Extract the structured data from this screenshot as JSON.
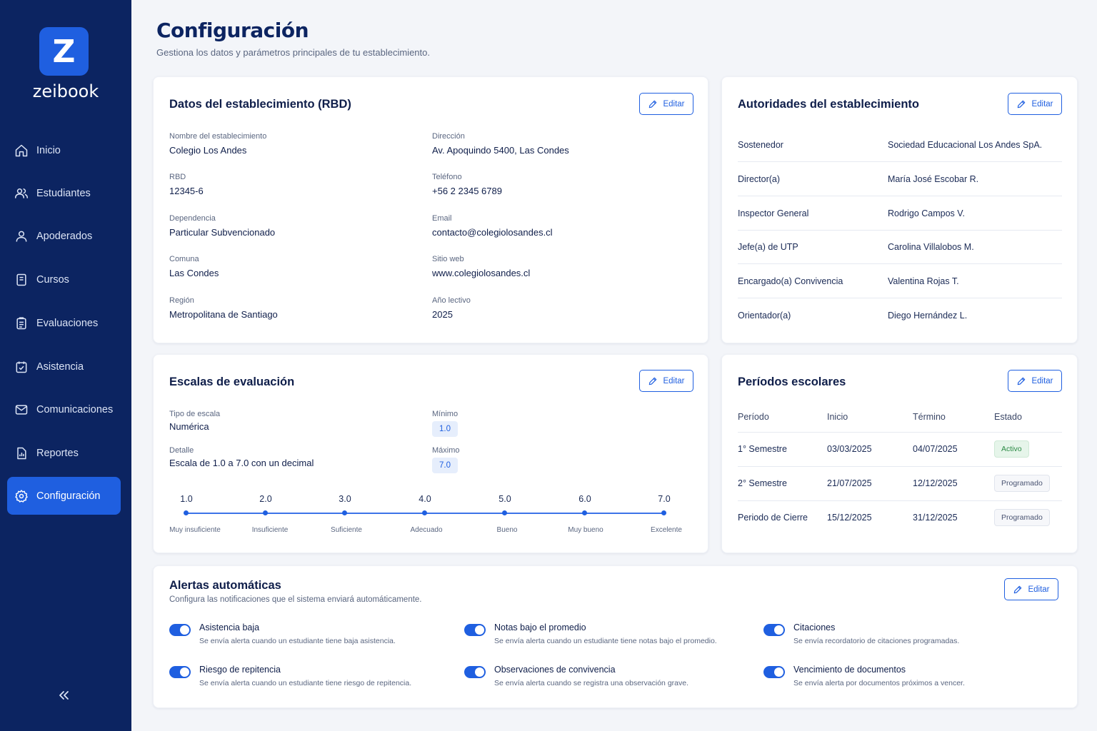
{
  "brand": {
    "letter": "Z",
    "name": "zeibook"
  },
  "sidebar": {
    "items": [
      {
        "label": "Inicio",
        "icon": "home-icon"
      },
      {
        "label": "Estudiantes",
        "icon": "users-icon"
      },
      {
        "label": "Apoderados",
        "icon": "user-icon"
      },
      {
        "label": "Cursos",
        "icon": "book-icon"
      },
      {
        "label": "Evaluaciones",
        "icon": "clipboard-icon"
      },
      {
        "label": "Asistencia",
        "icon": "calendar-check-icon"
      },
      {
        "label": "Comunicaciones",
        "icon": "mail-icon"
      },
      {
        "label": "Reportes",
        "icon": "report-icon"
      },
      {
        "label": "Configuración",
        "icon": "gear-icon",
        "active": true
      }
    ],
    "collapse_icon": "chevrons-left-icon"
  },
  "header": {
    "title": "Configuración",
    "subtitle": "Gestiona los datos y parámetros principales de tu establecimiento."
  },
  "edit_label": "Editar",
  "establishment": {
    "title": "Datos del establecimiento (RBD)",
    "left": [
      {
        "label": "Nombre del establecimiento",
        "value": "Colegio Los Andes"
      },
      {
        "label": "RBD",
        "value": "12345-6"
      },
      {
        "label": "Dependencia",
        "value": "Particular Subvencionado"
      },
      {
        "label": "Comuna",
        "value": "Las Condes"
      },
      {
        "label": "Región",
        "value": "Metropolitana de Santiago"
      }
    ],
    "right": [
      {
        "label": "Dirección",
        "value": "Av. Apoquindo 5400, Las Condes"
      },
      {
        "label": "Teléfono",
        "value": "+56 2 2345 6789"
      },
      {
        "label": "Email",
        "value": "contacto@colegiolosandes.cl"
      },
      {
        "label": "Sitio web",
        "value": "www.colegiolosandes.cl"
      },
      {
        "label": "Año lectivo",
        "value": "2025"
      }
    ]
  },
  "authorities": {
    "title": "Autoridades del establecimiento",
    "rows": [
      {
        "role": "Sostenedor",
        "name": "Sociedad Educacional Los Andes SpA."
      },
      {
        "role": "Director(a)",
        "name": "María José Escobar R."
      },
      {
        "role": "Inspector General",
        "name": "Rodrigo Campos V."
      },
      {
        "role": "Jefe(a) de UTP",
        "name": "Carolina Villalobos M."
      },
      {
        "role": "Encargado(a) Convivencia",
        "name": "Valentina Rojas T."
      },
      {
        "role": "Orientador(a)",
        "name": "Diego Hernández L."
      }
    ]
  },
  "scales": {
    "title": "Escalas de evaluación",
    "type_label": "Tipo de escala",
    "type_value": "Numérica",
    "detail_label": "Detalle",
    "detail_value": "Escala de 1.0 a 7.0 con un decimal",
    "min_label": "Mínimo",
    "min_value": "1.0",
    "max_label": "Máximo",
    "max_value": "7.0",
    "steps": [
      {
        "value": "1.0",
        "label": "Muy insuficiente"
      },
      {
        "value": "2.0",
        "label": "Insuficiente"
      },
      {
        "value": "3.0",
        "label": "Suficiente"
      },
      {
        "value": "4.0",
        "label": "Adecuado"
      },
      {
        "value": "5.0",
        "label": "Bueno"
      },
      {
        "value": "6.0",
        "label": "Muy bueno"
      },
      {
        "value": "7.0",
        "label": "Excelente"
      }
    ]
  },
  "periods": {
    "title": "Períodos escolares",
    "headers": [
      "Período",
      "Inicio",
      "Término",
      "Estado"
    ],
    "rows": [
      {
        "name": "1° Semestre",
        "start": "03/03/2025",
        "end": "04/07/2025",
        "status": "Activo"
      },
      {
        "name": "2° Semestre",
        "start": "21/07/2025",
        "end": "12/12/2025",
        "status": "Programado"
      },
      {
        "name": "Periodo de Cierre",
        "start": "15/12/2025",
        "end": "31/12/2025",
        "status": "Programado"
      }
    ]
  },
  "alerts": {
    "title": "Alertas automáticas",
    "subtitle": "Configura las notificaciones que el sistema enviará automáticamente.",
    "items": [
      {
        "title": "Asistencia baja",
        "desc": "Se envía alerta cuando un estudiante tiene baja asistencia.",
        "enabled": true
      },
      {
        "title": "Notas bajo el promedio",
        "desc": "Se envía alerta cuando un estudiante tiene notas bajo el promedio.",
        "enabled": true
      },
      {
        "title": "Citaciones",
        "desc": "Se envía recordatorio de citaciones programadas.",
        "enabled": true
      },
      {
        "title": "Riesgo de repitencia",
        "desc": "Se envía alerta cuando un estudiante tiene riesgo de repitencia.",
        "enabled": true
      },
      {
        "title": "Observaciones de convivencia",
        "desc": "Se envía alerta cuando se registra una observación grave.",
        "enabled": true
      },
      {
        "title": "Vencimiento de documentos",
        "desc": "Se envía alerta por documentos próximos a vencer.",
        "enabled": true
      }
    ]
  },
  "colors": {
    "sidebar": "#0c2461",
    "accent": "#1f5fe0",
    "success": "#2b8a44"
  }
}
